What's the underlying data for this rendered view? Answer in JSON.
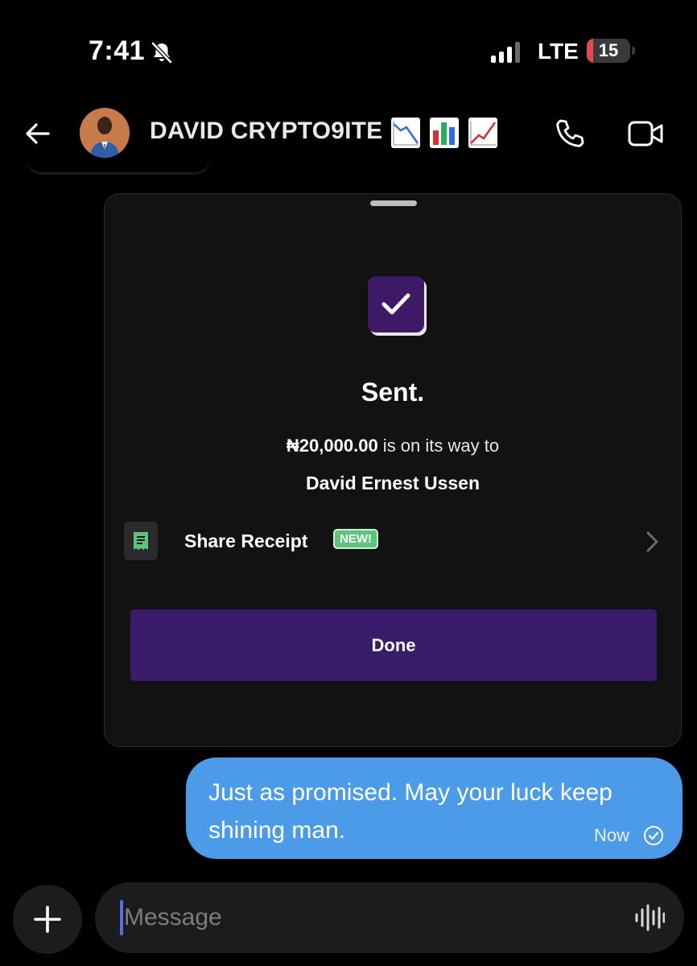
{
  "status_bar": {
    "time": "7:41",
    "network": "LTE",
    "battery_level": "15",
    "battery_fraction": 0.15,
    "battery_color": "#e5484d",
    "muted_icon": "bell-slash-icon"
  },
  "header": {
    "back_icon": "arrow-left-icon",
    "contact_name": "DAVID CRYPTO9ITE",
    "name_emojis": [
      "chart-decreasing-icon",
      "bar-chart-icon",
      "chart-increasing-icon"
    ],
    "call_icon": "phone-icon",
    "video_icon": "video-camera-icon"
  },
  "transfer_card": {
    "status_icon": "checkmark-icon",
    "title": "Sent.",
    "amount": "₦20,000.00",
    "amount_suffix": " is on its way to",
    "recipient": "David Ernest Ussen",
    "share_receipt_label": "Share Receipt",
    "new_badge": "NEW!",
    "done_label": "Done",
    "accent_color": "#3a1c6b"
  },
  "message": {
    "text": "Just as promised. May your luck keep shining man.",
    "time": "Now",
    "status_icon": "read-check-icon",
    "bubble_color": "#4c9be8"
  },
  "composer": {
    "placeholder": "Message",
    "add_icon": "plus-icon",
    "voice_icon": "waveform-icon"
  }
}
